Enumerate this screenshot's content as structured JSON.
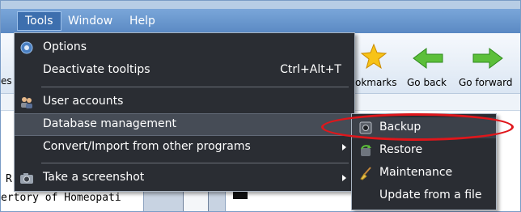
{
  "menubar": {
    "items": [
      {
        "label": "Tools",
        "active": true
      },
      {
        "label": "Window",
        "active": false
      },
      {
        "label": "Help",
        "active": false
      }
    ]
  },
  "toolbar": {
    "buttons": [
      {
        "label": "okmarks",
        "icon": "star-icon"
      },
      {
        "label": "Go back",
        "icon": "arrow-left-icon"
      },
      {
        "label": "Go forward",
        "icon": "arrow-right-icon"
      }
    ]
  },
  "background": {
    "left_fragment": "es",
    "doc_line": "ertory of Homeopati",
    "doc_letter": "R"
  },
  "tools_menu": {
    "items": [
      {
        "label": "Options",
        "icon": "options-gear-icon"
      },
      {
        "label": "Deactivate tooltips",
        "shortcut": "Ctrl+Alt+T"
      },
      {
        "label": "User accounts",
        "icon": "users-icon"
      },
      {
        "label": "Database management",
        "has_submenu": false,
        "highlighted": true
      },
      {
        "label": "Convert/Import from other programs",
        "has_submenu": true
      },
      {
        "label": "Take a screenshot",
        "icon": "camera-icon",
        "has_submenu": true
      }
    ]
  },
  "database_submenu": {
    "items": [
      {
        "label": "Backup",
        "icon": "backup-icon",
        "highlighted": true
      },
      {
        "label": "Restore",
        "icon": "restore-icon"
      },
      {
        "label": "Maintenance",
        "icon": "broom-icon"
      },
      {
        "label": "Update from a file"
      }
    ]
  },
  "colors": {
    "menu_bg": "#2a2d33",
    "annotation_ring": "#e0161b"
  }
}
